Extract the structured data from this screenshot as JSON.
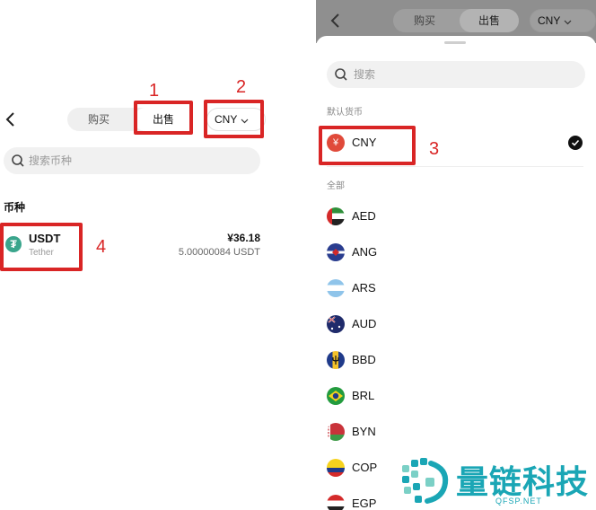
{
  "left": {
    "tabs": {
      "buy": "购买",
      "sell": "出售"
    },
    "currency": "CNY",
    "search_placeholder": "搜索币种",
    "section_title": "币种",
    "asset": {
      "symbol": "USDT",
      "name": "Tether",
      "fiat_value": "¥36.18",
      "amount": "5.00000084 USDT",
      "icon": "tether-icon"
    }
  },
  "right": {
    "tabs": {
      "buy": "购买",
      "sell": "出售"
    },
    "currency": "CNY",
    "search_placeholder": "搜索",
    "default_label": "默认货币",
    "all_label": "全部",
    "selected": {
      "code": "CNY",
      "symbol": "¥"
    },
    "currencies": [
      "AED",
      "ANG",
      "ARS",
      "AUD",
      "BBD",
      "BRL",
      "BYN",
      "COP",
      "EGP"
    ]
  },
  "annotations": {
    "n1": "1",
    "n2": "2",
    "n3": "3",
    "n4": "4"
  },
  "watermark": {
    "name": "量链科技",
    "domain": "QFSP.NET"
  },
  "colors": {
    "annotation_red": "#d92525",
    "tether_green": "#3aa58c",
    "watermark_teal": "#1aa6b5"
  }
}
